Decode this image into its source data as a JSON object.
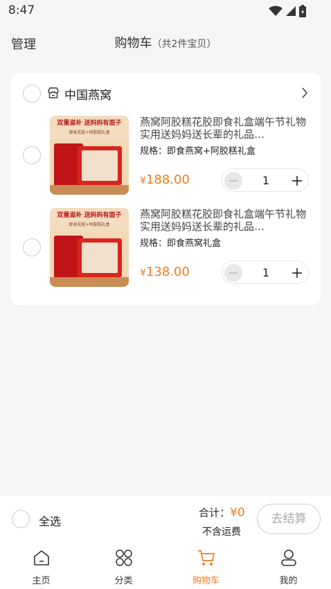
{
  "status_bar": {
    "time": "8:47"
  },
  "header": {
    "manage_label": "管理",
    "title": "购物车",
    "subtitle": "（共2件宝贝）"
  },
  "shop": {
    "name": "中国燕窝",
    "items": [
      {
        "thumb_headline": "双重滋补 送妈妈有面子",
        "thumb_sub": "即食花胶+阿胶糕礼盒",
        "title": "燕窝阿胶糕花胶即食礼盒端午节礼物实用送妈妈送长辈的礼品…",
        "spec": "规格：即食燕窝+阿胶糕礼盒",
        "currency": "¥",
        "price": "188.00",
        "quantity": "1"
      },
      {
        "thumb_headline": "双重滋补 送妈妈有面子",
        "thumb_sub": "即食花胶+阿胶糕礼盒",
        "title": "燕窝阿胶糕花胶即食礼盒端午节礼物实用送妈妈送长辈的礼品…",
        "spec": "规格：即食燕窝礼盒",
        "currency": "¥",
        "price": "138.00",
        "quantity": "1"
      }
    ]
  },
  "checkout": {
    "select_all_label": "全选",
    "total_label": "合计：",
    "total_value": "¥0",
    "shipping_note": "不含运费",
    "checkout_label": "去结算"
  },
  "tabbar": [
    {
      "label": "主页",
      "icon": "home-icon"
    },
    {
      "label": "分类",
      "icon": "category-icon"
    },
    {
      "label": "购物车",
      "icon": "cart-icon",
      "active": true
    },
    {
      "label": "我的",
      "icon": "profile-icon"
    }
  ],
  "colors": {
    "accent": "#f07c1c",
    "background": "#f5f5f5",
    "card": "#ffffff"
  }
}
